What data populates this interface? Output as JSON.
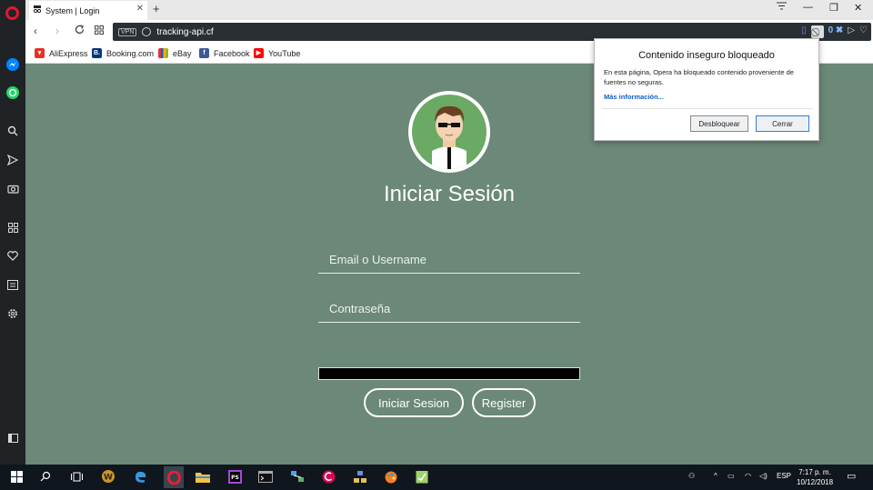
{
  "tab": {
    "title": "System | Login"
  },
  "address": {
    "vpn": "VPN",
    "url": "tracking-api.cf",
    "badge_count": "0"
  },
  "bookmarks": [
    {
      "label": "AliExpress",
      "color": "#e43225"
    },
    {
      "label": "Booking.com",
      "color": "#003580"
    },
    {
      "label": "eBay",
      "color": "#86b817"
    },
    {
      "label": "Facebook",
      "color": "#3b5998"
    },
    {
      "label": "YouTube",
      "color": "#ff0000"
    }
  ],
  "login": {
    "title": "Iniciar Sesión",
    "email_placeholder": "Email o Username",
    "password_placeholder": "Contraseña",
    "login_button": "Iniciar Sesion",
    "register_button": "Register"
  },
  "popup": {
    "title": "Contenido inseguro bloqueado",
    "body": "En esta página, Opera ha bloqueado contenido proveniente de fuentes no seguras.",
    "link": "Más información...",
    "unblock_button": "Desbloquear",
    "close_button": "Cerrar"
  },
  "taskbar": {
    "language": "ESP",
    "time": "7:17 p. m.",
    "date": "10/12/2018"
  },
  "colors": {
    "page_bg": "#6b8878",
    "accent": "#e0182d"
  }
}
